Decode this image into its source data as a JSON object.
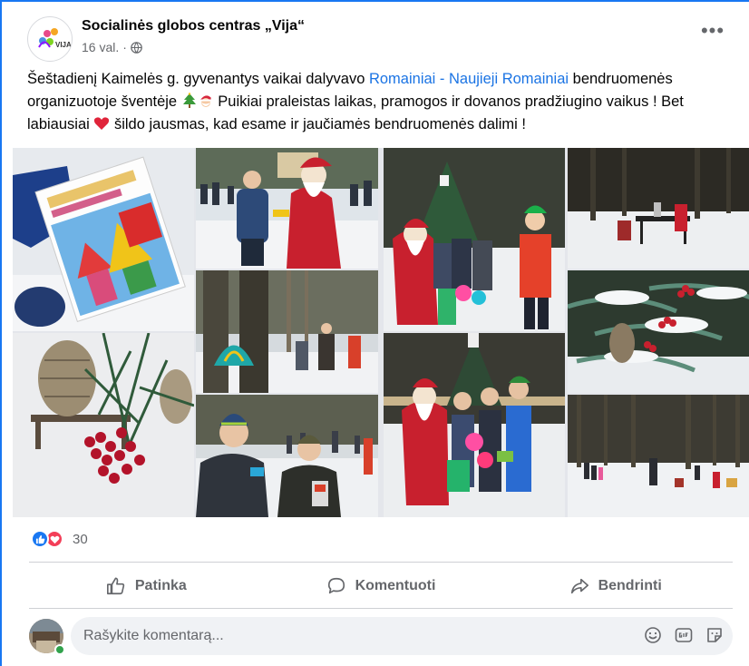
{
  "post": {
    "page_name": "Socialinės globos centras „Vija“",
    "time": "16 val.",
    "separator": "·",
    "logo_text": "VIJA",
    "text": {
      "part1": "Šeštadienį Kaimelės g. gyvenantys vaikai dalyvavo ",
      "link1": "Romainiai - ",
      "space": " ",
      "link2": "Naujieji Romainiai",
      "part2": " bendruomenės organizuotoje šventėje ",
      "part3": " Puikiai praleistas laikas, pramogos ir dovanos pradžiugino vaikus ! Bet labiausiai ",
      "part4": " šildo jausmas, kad esame ir jaučiamės bendruomenės dalimi !"
    },
    "icons": {
      "globe": "globe-icon",
      "more": "more-options-icon",
      "tree": "christmas-tree-emoji",
      "santa": "santa-emoji",
      "heart": "red-heart-emoji"
    }
  },
  "gallery": {
    "photos": [
      "gift-box-photo",
      "santa-giving-gift-photo",
      "santa-group-photo",
      "outdoor-table-photo",
      "umbrella-trees-photo",
      "snowy-pine-berries-photo",
      "pine-cone-berries-photo",
      "santa-children-balloons-photo",
      "children-with-gifts-photo",
      "snowy-park-crowd-photo"
    ]
  },
  "reactions": {
    "count": "30",
    "types": [
      "like",
      "love"
    ]
  },
  "actions": {
    "like": "Patinka",
    "comment": "Komentuoti",
    "share": "Bendrinti"
  },
  "comment": {
    "placeholder": "Rašykite komentarą...",
    "icons": [
      "emoji-icon",
      "gif-icon",
      "sticker-icon"
    ]
  },
  "colors": {
    "link": "#1b74e4",
    "secondary_text": "#65676b",
    "like_blue": "#1877f2",
    "love_red": "#f33e58",
    "online_green": "#31a24c",
    "comment_bg": "#f0f2f5"
  }
}
